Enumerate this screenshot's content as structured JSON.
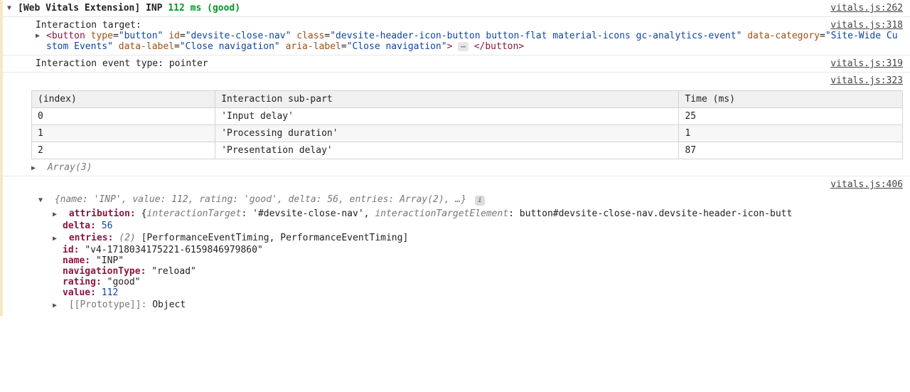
{
  "header": {
    "prefix": "[Web Vitals Extension]",
    "metric": "INP",
    "value": "112 ms",
    "rating": "(good)",
    "source": "vitals.js:262"
  },
  "target": {
    "label": "Interaction target:",
    "source": "vitals.js:318",
    "element": {
      "tag_open": "<button",
      "type_attr": "type",
      "type_val": "\"button\"",
      "id_attr": "id",
      "id_val": "\"devsite-close-nav\"",
      "class_attr": "class",
      "class_val": "\"devsite-header-icon-button button-flat material-icons gc-analytics-event\"",
      "data_cat_attr": "data-category",
      "data_cat_val": "\"Site-Wide Custom Events\"",
      "data_label_attr": "data-label",
      "data_label_val": "\"Close navigation\"",
      "aria_attr": "aria-label",
      "aria_val": "\"Close navigation\"",
      "close_gt": ">",
      "ellipsis": "⋯",
      "tag_close": "</button>"
    }
  },
  "event_type": {
    "text": "Interaction event type: pointer",
    "source": "vitals.js:319"
  },
  "table_block": {
    "source": "vitals.js:323",
    "headers": {
      "c0": "(index)",
      "c1": "Interaction sub-part",
      "c2": "Time (ms)"
    },
    "rows": [
      {
        "idx": "0",
        "part": "'Input delay'",
        "time": "25"
      },
      {
        "idx": "1",
        "part": "'Processing duration'",
        "time": "1"
      },
      {
        "idx": "2",
        "part": "'Presentation delay'",
        "time": "87"
      }
    ],
    "footer": "Array(3)"
  },
  "object": {
    "source": "vitals.js:406",
    "preview_open": "{",
    "preview": "name: 'INP', value: 112, rating: 'good', delta: 56, entries: Array(2), …",
    "preview_close": "}",
    "attribution_key": "attribution:",
    "attribution_open": "{",
    "attribution_k1": "interactionTarget",
    "attribution_v1": ": '#devsite-close-nav', ",
    "attribution_k2": "interactionTargetElement",
    "attribution_v2": ": button#devsite-close-nav.devsite-header-icon-butt",
    "delta_key": "delta:",
    "delta_val": "56",
    "entries_key": "entries:",
    "entries_count": "(2)",
    "entries_val": "[PerformanceEventTiming, PerformanceEventTiming]",
    "id_key": "id:",
    "id_val": "\"v4-1718034175221-6159846979860\"",
    "name_key": "name:",
    "name_val": "\"INP\"",
    "nav_key": "navigationType:",
    "nav_val": "\"reload\"",
    "rating_key": "rating:",
    "rating_val": "\"good\"",
    "value_key": "value:",
    "value_val": "112",
    "proto_key": "[[Prototype]]:",
    "proto_val": "Object"
  }
}
